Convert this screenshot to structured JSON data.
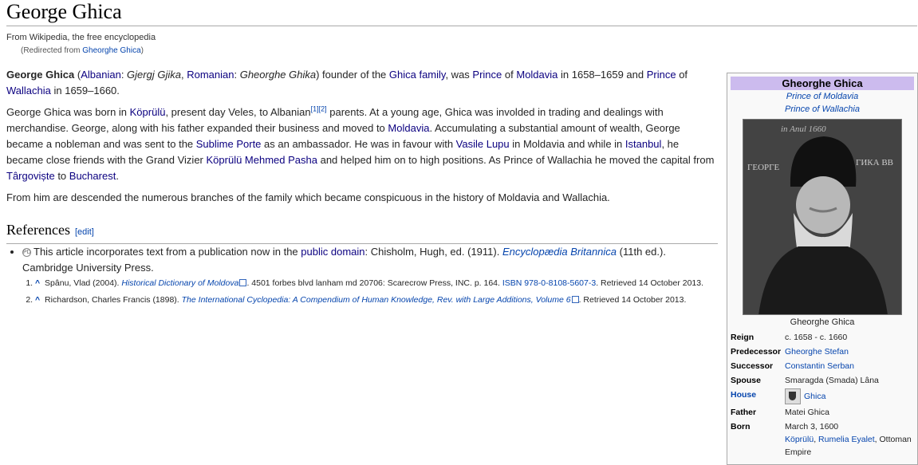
{
  "page": {
    "title": "George Ghica",
    "tagline": "From Wikipedia, the free encyclopedia",
    "redirect_prefix": "(Redirected from ",
    "redirect_link": "Gheorghe Ghica",
    "redirect_suffix": ")"
  },
  "intro": {
    "bold_name": "George Ghica",
    "t1": " (",
    "l_albanian": "Albanian",
    "t2": ": ",
    "alb_name": "Gjergj Gjika",
    "t3": ", ",
    "l_romanian": "Romanian",
    "t4": ": ",
    "rom_name": "Gheorghe Ghika",
    "t5": ") founder of the ",
    "l_family": "Ghica family",
    "t6": ", was ",
    "l_prince1": "Prince",
    "t7": " of ",
    "l_moldavia": "Moldavia",
    "t8": " in 1658–1659 and ",
    "l_prince2": "Prince",
    "t9": " of ",
    "l_wallachia": "Wallachia",
    "t10": " in 1659–1660."
  },
  "bio": {
    "t1": "George Ghica was born in ",
    "l_koprulu": "Köprülü",
    "t2": ", present day Veles, to Albanian",
    "ref1": "[1]",
    "ref2": "[2]",
    "t3": " parents. At a young age, Ghica was involded in trading and dealings with merchandise. George, along with his father expanded their business and moved to ",
    "l_moldavia": "Moldavia",
    "t4": ". Accumulating a substantial amount of wealth, George became a nobleman and was sent to the ",
    "l_porte": "Sublime Porte",
    "t5": " as an ambassador. He was in favour with ",
    "l_lupu": "Vasile Lupu",
    "t6": " in Moldavia and while in ",
    "l_istanbul": "Istanbul",
    "t7": ", he became close friends with the Grand Vizier ",
    "l_pasha": "Köprülü Mehmed Pasha",
    "t8": " and helped him on to high positions. As Prince of Wallachia he moved the capital from ",
    "l_targoviste": "Târgoviște",
    "t9": " to ",
    "l_bucharest": "Bucharest",
    "t10": "."
  },
  "descended": "From him are descended the numerous branches of the family which became conspicuous in the history of Moldavia and Wallachia.",
  "references": {
    "heading": "References",
    "edit": "[edit]",
    "pd_icon": "public-domain-icon",
    "pd_t1": "This article incorporates text from a publication now in the ",
    "pd_link": "public domain",
    "pd_t2": ": Chisholm, Hugh, ed. (1911). ",
    "pd_book": "Encyclopædia Britannica",
    "pd_t3": " (11th ed.). Cambridge University Press.",
    "items": [
      {
        "caret": "^",
        "t1": " Spânu, Vlad (2004). ",
        "title": "Historical Dictionary of Moldova",
        "t2": ". 4501 forbes blvd lanham md 20706: Scarecrow Press, INC. p. 164. ",
        "isbn": "ISBN 978-0-8108-5607-3",
        "t3": ". Retrieved 14 October 2013."
      },
      {
        "caret": "^",
        "t1": " Richardson, Charles Francis (1898). ",
        "title": "The International Cyclopedia: A Compendium of Human Knowledge, Rev. with Large Additions, Volume 6",
        "t2": "",
        "isbn": "",
        "t3": ". Retrieved 14 October 2013."
      }
    ]
  },
  "infobox": {
    "title": "Gheorghe Ghica",
    "sub1": "Prince of Moldavia",
    "sub2": "Prince of Wallachia",
    "portrait_top_text": "in Anul 1660",
    "portrait_left_text": "ГЕОРГЕ",
    "portrait_right_text": "ГИКА ВВ",
    "caption": "Gheorghe Ghica",
    "reign_label": "Reign",
    "reign_value": "c. 1658 - c. 1660",
    "predecessor_label": "Predecessor",
    "predecessor_value": "Gheorghe Stefan",
    "successor_label": "Successor",
    "successor_value": "Constantin Serban",
    "spouse_label": "Spouse",
    "spouse_value": "Smaragda (Smada) Lâna",
    "house_label": "House",
    "house_value": "Ghica",
    "father_label": "Father",
    "father_value": "Matei Ghica",
    "born_label": "Born",
    "born_date": "March 3, 1600",
    "born_place1": "Köprülü",
    "born_sep": ", ",
    "born_place2": "Rumelia Eyalet",
    "born_place3": ", Ottoman Empire"
  }
}
